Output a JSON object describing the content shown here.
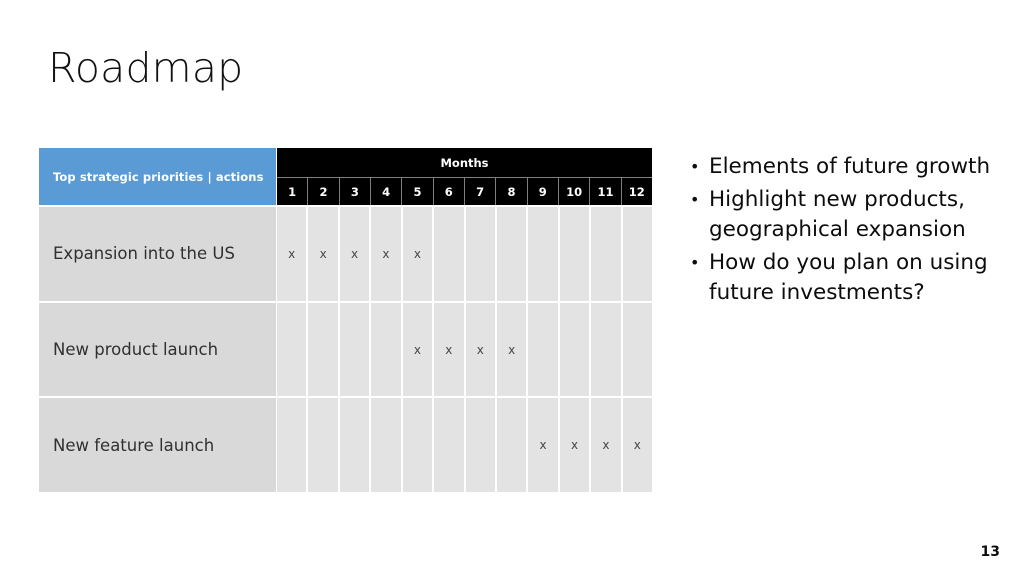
{
  "slide": {
    "title": "Roadmap",
    "page_number": "13"
  },
  "colors": {
    "header_blue": "#5B9BD5",
    "header_black": "#000000",
    "row_label_gray": "#D9D9D9",
    "grid_cell_gray": "#E3E3E3",
    "text_dark": "#0D0D0D",
    "background": "#FFFFFF"
  },
  "table": {
    "priorities_header": "Top strategic priorities | actions",
    "months_header": "Months",
    "month_labels": [
      "1",
      "2",
      "3",
      "4",
      "5",
      "6",
      "7",
      "8",
      "9",
      "10",
      "11",
      "12"
    ],
    "mark": "x",
    "rows": [
      {
        "label": "Expansion into the US",
        "marks": [
          true,
          true,
          true,
          true,
          true,
          false,
          false,
          false,
          false,
          false,
          false,
          false
        ]
      },
      {
        "label": "New product launch",
        "marks": [
          false,
          false,
          false,
          false,
          true,
          true,
          true,
          true,
          false,
          false,
          false,
          false
        ]
      },
      {
        "label": "New feature launch",
        "marks": [
          false,
          false,
          false,
          false,
          false,
          false,
          false,
          false,
          true,
          true,
          true,
          true
        ]
      }
    ]
  },
  "bullets": {
    "marker": "•",
    "items": [
      "Elements of future growth",
      "Highlight new products, geographical expansion",
      "How do you plan on using future investments?"
    ]
  }
}
